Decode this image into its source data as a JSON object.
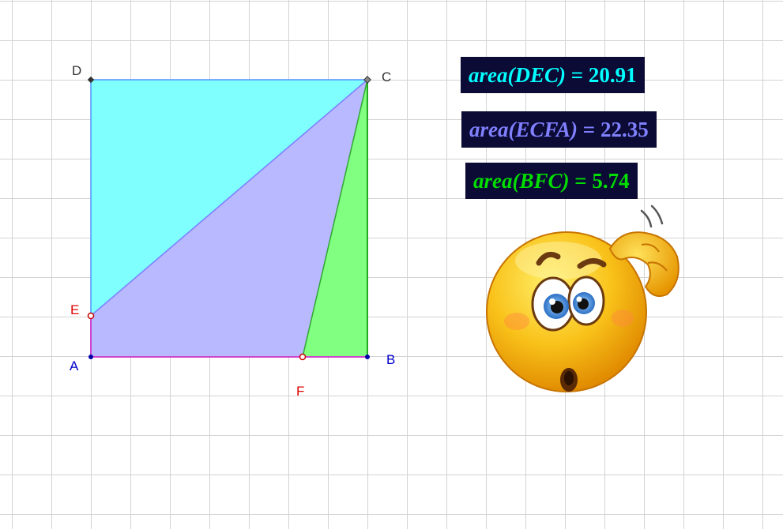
{
  "points": {
    "A": {
      "label": "A",
      "color": "#0000cc"
    },
    "B": {
      "label": "B",
      "color": "#0000cc"
    },
    "C": {
      "label": "C",
      "color": "#333333"
    },
    "D": {
      "label": "D",
      "color": "#333333"
    },
    "E": {
      "label": "E",
      "color": "#e00000"
    },
    "F": {
      "label": "F",
      "color": "#e00000"
    }
  },
  "regions": {
    "DEC": {
      "fill": "#80ffff",
      "stroke": "#4d94ff"
    },
    "ECFA": {
      "fill": "#b9b9ff",
      "stroke": "#8080ff"
    },
    "BFC": {
      "fill": "#80ff80",
      "stroke": "#33aa33"
    }
  },
  "areas": [
    {
      "fn": "area",
      "arg": "(DEC)",
      "eq": " = ",
      "value": "20.91",
      "color": "#00ffff"
    },
    {
      "fn": "area",
      "arg": "(ECFA)",
      "eq": " = ",
      "value": "22.35",
      "color": "#8080ff"
    },
    {
      "fn": "area",
      "arg": "(BFC)",
      "eq": " = ",
      "value": "5.74",
      "color": "#00dd00"
    }
  ],
  "decoration": {
    "emoji": "confused-thinking-emoji"
  }
}
